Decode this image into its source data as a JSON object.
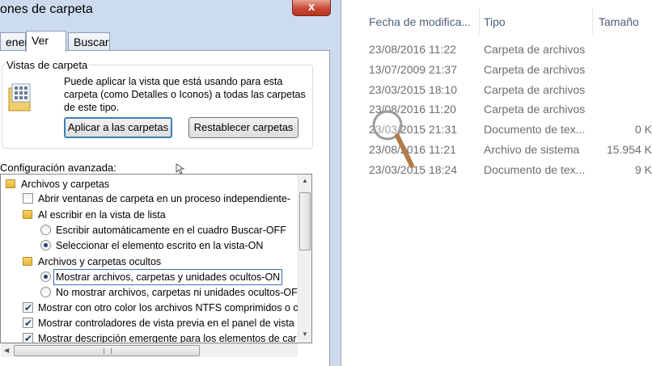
{
  "dialog": {
    "title": "ones de carpeta",
    "close_label": "x",
    "tabs": [
      {
        "label": "eneral",
        "active": false
      },
      {
        "label": "Ver",
        "active": true
      },
      {
        "label": "Buscar",
        "active": false
      }
    ],
    "folder_views": {
      "legend": "Vistas de carpeta",
      "description": "Puede aplicar la vista que está usando para esta carpeta (como Detalles o Iconos) a todas las carpetas de este tipo.",
      "apply_button": "Aplicar a las carpetas",
      "reset_button": "Restablecer carpetas"
    },
    "advanced": {
      "label": "Configuración avanzada:",
      "items": [
        {
          "type": "folder",
          "text": "Archivos y carpetas"
        },
        {
          "type": "checkbox",
          "checked": false,
          "text": "Abrir ventanas de carpeta  en un proceso independiente-"
        },
        {
          "type": "folder",
          "text": "Al escribir en la vista de lista"
        },
        {
          "type": "radio",
          "checked": false,
          "text": "Escribir automáticamente en el cuadro Buscar-OFF"
        },
        {
          "type": "radio",
          "checked": true,
          "text": "Seleccionar el elemento escrito en la vista-ON"
        },
        {
          "type": "folder",
          "text": "Archivos y carpetas ocultos"
        },
        {
          "type": "radio",
          "checked": true,
          "text": "Mostrar archivos, carpetas y unidades ocultos-ON",
          "selected": true
        },
        {
          "type": "radio",
          "checked": false,
          "text": "No mostrar archivos, carpetas ni unidades ocultos-OF"
        },
        {
          "type": "checkbox",
          "checked": true,
          "text": "Mostrar con otro color los archivos NTFS comprimidos o c"
        },
        {
          "type": "checkbox",
          "checked": true,
          "text": "Mostrar controladores de vista previa en el panel de vista"
        },
        {
          "type": "checkbox",
          "checked": true,
          "text": "Mostrar descripción emergente para los elementos de car"
        }
      ]
    },
    "colors": {
      "accent": "#3b6fb5",
      "folder": "#e5b53a",
      "close": "#c74a36"
    }
  },
  "explorer": {
    "headers": {
      "date": "Fecha de modifica...",
      "type": "Tipo",
      "size": "Tamaño"
    },
    "rows": [
      {
        "date": "23/08/2016 11:22",
        "type": "Carpeta de archivos",
        "size": ""
      },
      {
        "date": "13/07/2009 21:37",
        "type": "Carpeta de archivos",
        "size": ""
      },
      {
        "date": "23/03/2015 18:10",
        "type": "Carpeta de archivos",
        "size": ""
      },
      {
        "date": "23/08/2016 11:20",
        "type": "Carpeta de archivos",
        "size": ""
      },
      {
        "date": "23/03/2015 21:31",
        "type": "Documento de tex...",
        "size": "0 K"
      },
      {
        "date": "23/08/2016 11:21",
        "type": "Archivo de sistema",
        "size": "15.954 K"
      },
      {
        "date": "23/03/2015 18:24",
        "type": "Documento de tex...",
        "size": "9 K"
      }
    ]
  }
}
